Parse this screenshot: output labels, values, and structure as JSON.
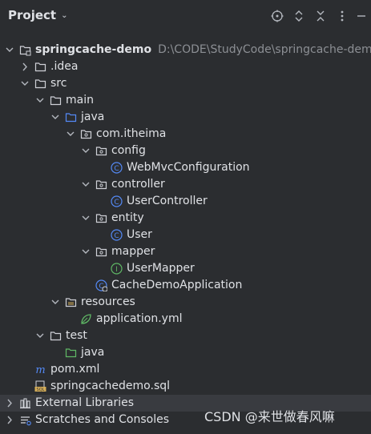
{
  "panel": {
    "title": "Project",
    "toolbar": [
      "locate-icon",
      "expand-all-icon",
      "collapse-all-icon",
      "more-icon",
      "minimize-icon"
    ]
  },
  "tree": [
    {
      "name": "project-root",
      "label": "springcache-demo",
      "path": "D:\\CODE\\StudyCode\\springcache-dem",
      "arrow": "down",
      "icon": "folder-module"
    },
    {
      "name": "idea-folder",
      "label": ".idea",
      "arrow": "right",
      "icon": "folder"
    },
    {
      "name": "src-folder",
      "label": "src",
      "arrow": "down",
      "icon": "folder"
    },
    {
      "name": "main-folder",
      "label": "main",
      "arrow": "down",
      "icon": "folder"
    },
    {
      "name": "java-folder",
      "label": "java",
      "arrow": "down",
      "icon": "folder-source"
    },
    {
      "name": "package-com-itheima",
      "label": "com.itheima",
      "arrow": "down",
      "icon": "package"
    },
    {
      "name": "package-config",
      "label": "config",
      "arrow": "down",
      "icon": "package"
    },
    {
      "name": "class-webmvcconfiguration",
      "label": "WebMvcConfiguration",
      "arrow": "",
      "icon": "class"
    },
    {
      "name": "package-controller",
      "label": "controller",
      "arrow": "down",
      "icon": "package"
    },
    {
      "name": "class-usercontroller",
      "label": "UserController",
      "arrow": "",
      "icon": "class"
    },
    {
      "name": "package-entity",
      "label": "entity",
      "arrow": "down",
      "icon": "package"
    },
    {
      "name": "class-user",
      "label": "User",
      "arrow": "",
      "icon": "class"
    },
    {
      "name": "package-mapper",
      "label": "mapper",
      "arrow": "down",
      "icon": "package"
    },
    {
      "name": "interface-usermapper",
      "label": "UserMapper",
      "arrow": "",
      "icon": "interface"
    },
    {
      "name": "class-cachedemoapplication",
      "label": "CacheDemoApplication",
      "arrow": "",
      "icon": "class-main"
    },
    {
      "name": "resources-folder",
      "label": "resources",
      "arrow": "down",
      "icon": "folder-resources"
    },
    {
      "name": "file-application-yml",
      "label": "application.yml",
      "arrow": "",
      "icon": "yml"
    },
    {
      "name": "test-folder",
      "label": "test",
      "arrow": "down",
      "icon": "folder"
    },
    {
      "name": "test-java-folder",
      "label": "java",
      "arrow": "",
      "icon": "folder-test"
    },
    {
      "name": "file-pom-xml",
      "label": "pom.xml",
      "arrow": "",
      "icon": "maven"
    },
    {
      "name": "file-springcachedemo-sql",
      "label": "springcachedemo.sql",
      "arrow": "",
      "icon": "sql"
    },
    {
      "name": "external-libraries",
      "label": "External Libraries",
      "arrow": "right",
      "icon": "libraries"
    },
    {
      "name": "scratches-and-consoles",
      "label": "Scratches and Consoles",
      "arrow": "right",
      "icon": "scratches"
    }
  ],
  "watermark": "CSDN @来世做春风嘛"
}
